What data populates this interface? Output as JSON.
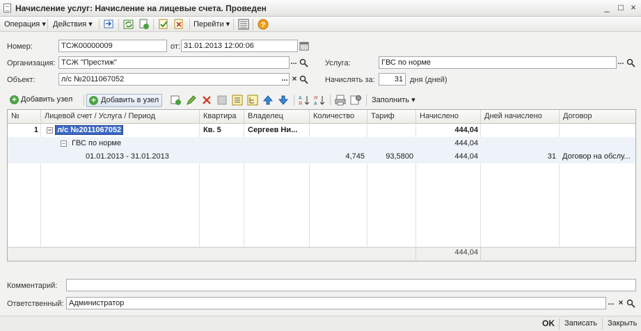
{
  "window": {
    "title": "Начисление услуг: Начисление на лицевые счета. Проведен"
  },
  "toolbar": {
    "operation": "Операция",
    "actions": "Действия",
    "goto": "Перейти"
  },
  "form": {
    "number_label": "Номер:",
    "number": "ТСЖ00000009",
    "date_label": "от:",
    "date": "31.01.2013 12:00:06",
    "org_label": "Организация:",
    "org": "ТСЖ \"Престиж\"",
    "object_label": "Объект:",
    "object": "л/с №2011067052",
    "service_label": "Услуга:",
    "service": "ГВС по норме",
    "charge_for_label": "Начислять за:",
    "charge_for": "31",
    "days_label": "дня (дней)"
  },
  "table_toolbar": {
    "add_node": "Добавить узел",
    "add_to_node": "Добавить в узел",
    "fill": "Заполнить"
  },
  "table": {
    "columns": [
      "№",
      "Лицевой счет / Услуга / Период",
      "Квартира",
      "Владелец",
      "Количество",
      "Тариф",
      "Начислено",
      "Дней начислено",
      "Договор"
    ],
    "rows": [
      {
        "num": "1",
        "account": "л/с №2011067052",
        "apartment": "Кв. 5",
        "owner": "Сергеев Ни...",
        "qty": "",
        "tariff": "",
        "charged": "444,04",
        "days": "",
        "contract": ""
      },
      {
        "num": "",
        "account": "ГВС по норме",
        "apartment": "",
        "owner": "",
        "qty": "",
        "tariff": "",
        "charged": "444,04",
        "days": "",
        "contract": ""
      },
      {
        "num": "",
        "account": "01.01.2013 - 31.01.2013",
        "apartment": "",
        "owner": "",
        "qty": "4,745",
        "tariff": "93,5800",
        "charged": "444,04",
        "days": "31",
        "contract": "Договор на обслу..."
      }
    ],
    "total_charged": "444,04"
  },
  "footer": {
    "comment_label": "Комментарий:",
    "comment": "",
    "responsible_label": "Ответственный:",
    "responsible": "Администратор"
  },
  "bottom": {
    "ok": "OK",
    "save": "Записать",
    "close": "Закрыть"
  }
}
